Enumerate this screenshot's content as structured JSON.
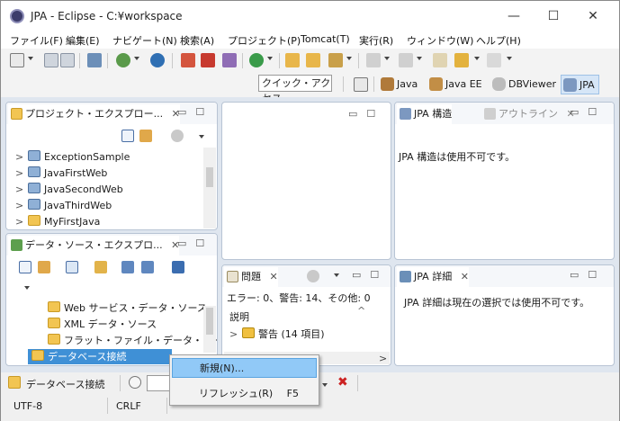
{
  "window": {
    "title": "JPA - Eclipse - C:¥workspace",
    "min": "—",
    "max": "☐",
    "close": "✕"
  },
  "menus": [
    "ファイル(F)",
    "編集(E)",
    "ナビゲート(N)",
    "検索(A)",
    "プロジェクト(P)",
    "Tomcat(T)",
    "実行(R)",
    "ウィンドウ(W)",
    "ヘルプ(H)"
  ],
  "quick_access": "クイック・アクセス",
  "perspectives": [
    "Java",
    "Java EE",
    "DBViewer",
    "JPA"
  ],
  "project_explorer": {
    "tab": "プロジェクト・エクスプロー...",
    "items": [
      "ExceptionSample",
      "JavaFirstWeb",
      "JavaSecondWeb",
      "JavaThirdWeb",
      "MyFirstJava"
    ]
  },
  "data_source": {
    "tab": "データ・ソース・エクスプロ...",
    "items": [
      "Web サービス・データ・ソース",
      "XML データ・ソース",
      "フラット・ファイル・データ・ソース",
      "データベース接続"
    ]
  },
  "jpa_structure": {
    "tab": "JPA 構造",
    "tab2": "アウトライン",
    "message": "JPA 構造は使用不可です。"
  },
  "problems": {
    "tab": "問題",
    "summary": "エラー: 0、警告: 14、その他: 0",
    "column": "説明",
    "group": "警告 (14 項目)"
  },
  "jpa_details": {
    "tab": "JPA 詳細",
    "message": "JPA 詳細は現在の選択では使用不可です。"
  },
  "status_bar": {
    "db_label": "データベース接続",
    "encoding": "UTF-8",
    "line_ending": "CRLF"
  },
  "context_menu": {
    "items": [
      {
        "label": "新規(N)...",
        "shortcut": ""
      },
      {
        "label": "リフレッシュ(R)",
        "shortcut": "F5"
      }
    ]
  },
  "colors": {
    "selection": "#3f90d6",
    "menu_highlight": "#91c9f7",
    "workarea": "#dfe6ef"
  }
}
